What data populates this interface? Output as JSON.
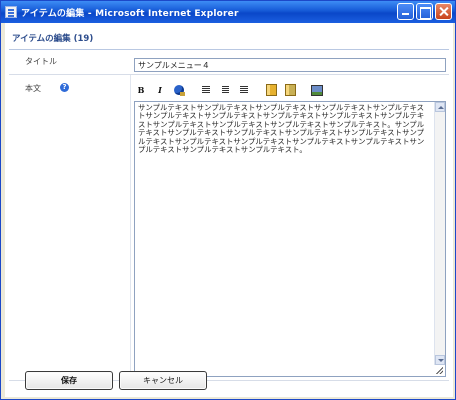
{
  "window": {
    "title": "アイテムの編集 - Microsoft Internet Explorer"
  },
  "page": {
    "heading": "アイテムの編集 (19)"
  },
  "form": {
    "title_label": "タイトル",
    "title_value": "サンプルメニュー４",
    "body_label": "本文",
    "help_icon_text": "?",
    "toolbar": {
      "bold": "B",
      "italic": "I"
    },
    "body_text": "サンプルテキストサンプルテキストサンプルテキストサンプルテキストサンプルテキストサンプルテキストサンプルテキストサンプルテキストサンプルテキストサンプルテキストサンプルテキストサンプルテキストサンプルテキストサンプルテキスト。サンプルテキストサンプルテキストサンプルテキストサンプルテキストサンプルテキストサンプルテキストサンプルテキストサンプルテキストサンプルテキストサンプルテキストサンプルテキストサンプルテキストサンプルテキスト。"
  },
  "buttons": {
    "save": "保存",
    "cancel": "キャンセル"
  },
  "colors": {
    "titlebar": "#1559d6",
    "heading": "#2c4c8c",
    "close": "#c8431c"
  }
}
